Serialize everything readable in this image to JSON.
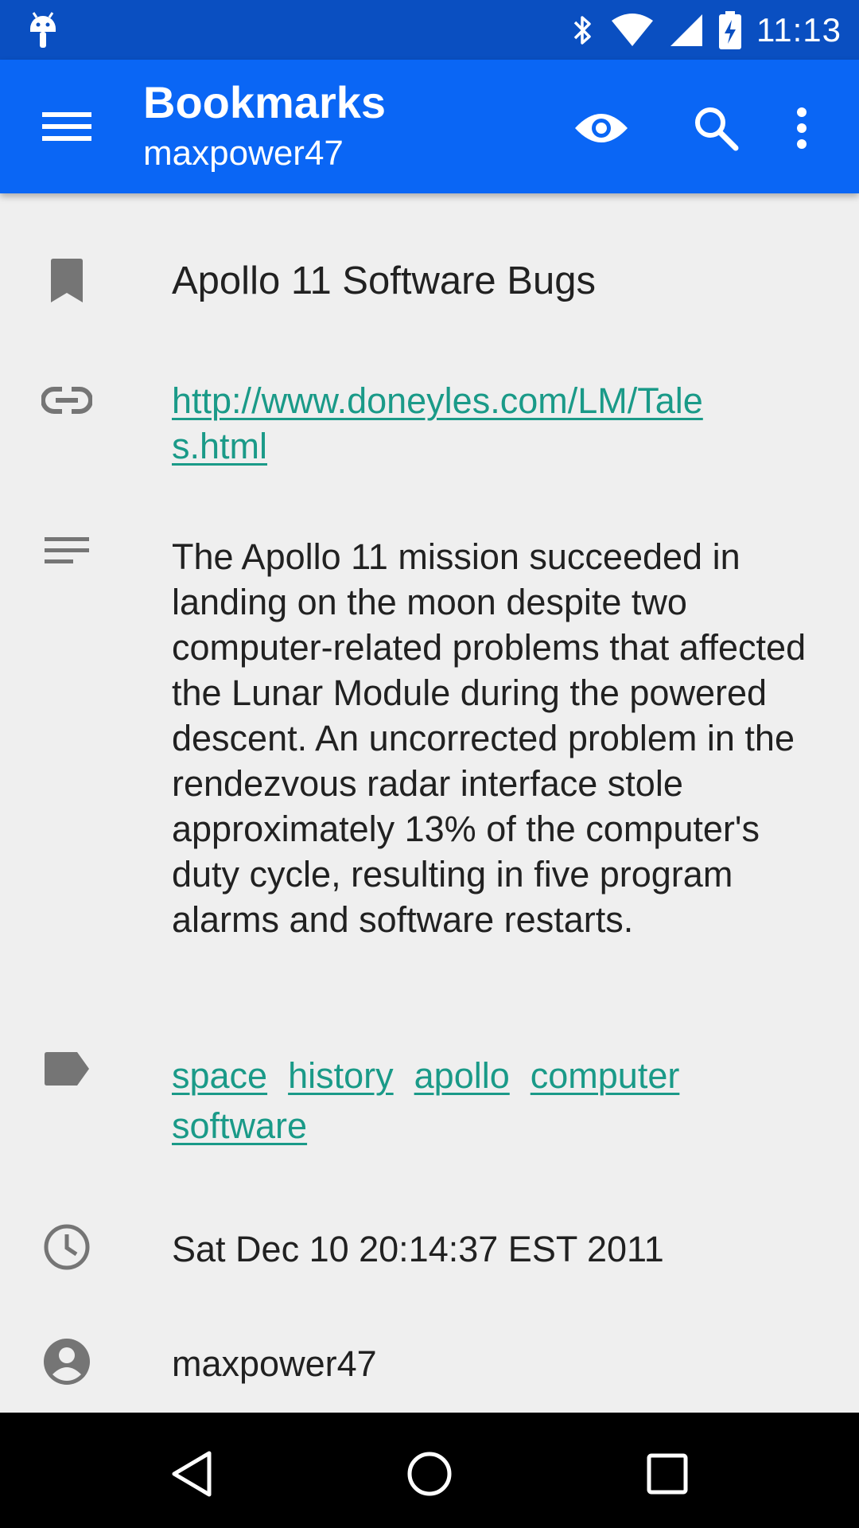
{
  "status_bar": {
    "time": "11:13",
    "icons": [
      "android-debug-icon",
      "bluetooth-icon",
      "wifi-icon",
      "signal-icon",
      "battery-charging-icon"
    ]
  },
  "app_bar": {
    "title": "Bookmarks",
    "subtitle": "maxpower47",
    "background": "#0a66f5",
    "actions": [
      "menu-icon",
      "eye-icon",
      "search-icon",
      "more-vert-icon"
    ]
  },
  "bookmark": {
    "title": "Apollo 11 Software Bugs",
    "url": "http://www.doneyles.com/LM/Tales.html",
    "description": "The Apollo 11 mission succeeded in landing on the moon despite two computer-related problems that affected the Lunar Module during the powered descent. An uncorrected problem in the rendezvous radar interface stole approximately 13% of the computer's duty cycle, resulting in five program alarms and software restarts.",
    "tags": [
      "space",
      "history",
      "apollo",
      "computer",
      "software"
    ],
    "date": "Sat Dec 10 20:14:37 EST 2011",
    "user": "maxpower47",
    "link_color": "#1a9a88"
  },
  "nav_bar": {
    "buttons": [
      "back-icon",
      "home-icon",
      "recents-icon"
    ]
  }
}
